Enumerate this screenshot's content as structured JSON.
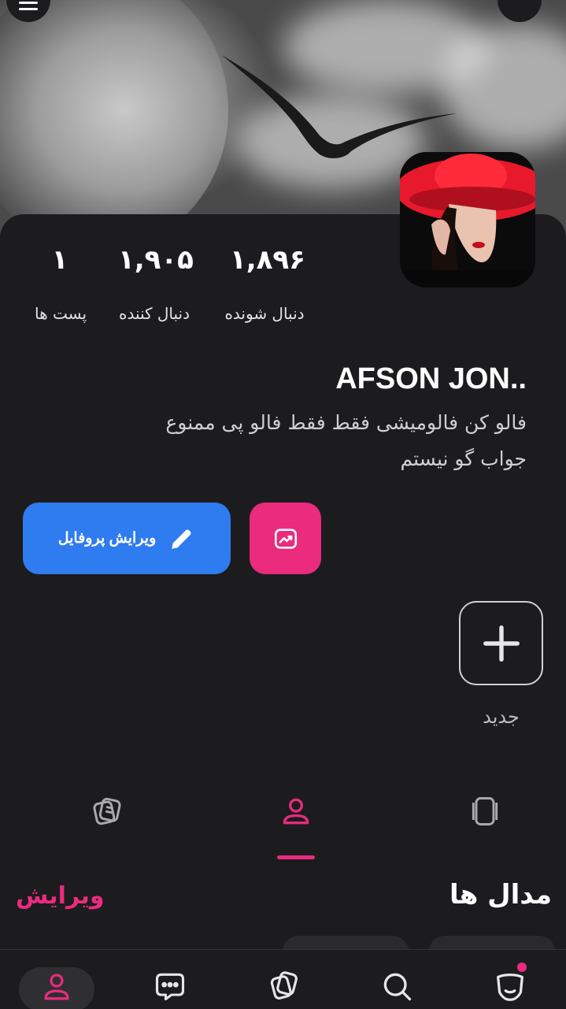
{
  "profile": {
    "name": "AFSON JON..",
    "bio_line1": "فالو کن فالومیشی فقط فقط  فالو پی ممنوع",
    "bio_line2": "جواب گو نیستم"
  },
  "stats": {
    "followers": {
      "value": "۱,۸۹۶",
      "label": "دنبال شونده"
    },
    "following": {
      "value": "۱,۹۰۵",
      "label": "دنبال کننده"
    },
    "posts": {
      "value": "۱",
      "label": "پست ها"
    }
  },
  "actions": {
    "edit_profile_label": "ویرایش پروفایل",
    "stats_icon": "trending-up-icon"
  },
  "stories": {
    "new_label": "جدید"
  },
  "content_tabs": [
    {
      "name": "posts",
      "icon": "notes-icon"
    },
    {
      "name": "profile",
      "icon": "user-icon"
    },
    {
      "name": "stories",
      "icon": "cards-icon"
    }
  ],
  "medals": {
    "title": "مدال ها",
    "edit_label": "ویرایش"
  },
  "bottom_nav": [
    {
      "name": "profile",
      "icon": "user-icon"
    },
    {
      "name": "messages",
      "icon": "chat-icon"
    },
    {
      "name": "feed",
      "icon": "cards-icon"
    },
    {
      "name": "search",
      "icon": "search-icon"
    },
    {
      "name": "notifications",
      "icon": "face-icon"
    }
  ],
  "colors": {
    "accent_pink": "#ea2b7e",
    "accent_blue": "#2f7bf0",
    "background": "#1c1c1e"
  }
}
